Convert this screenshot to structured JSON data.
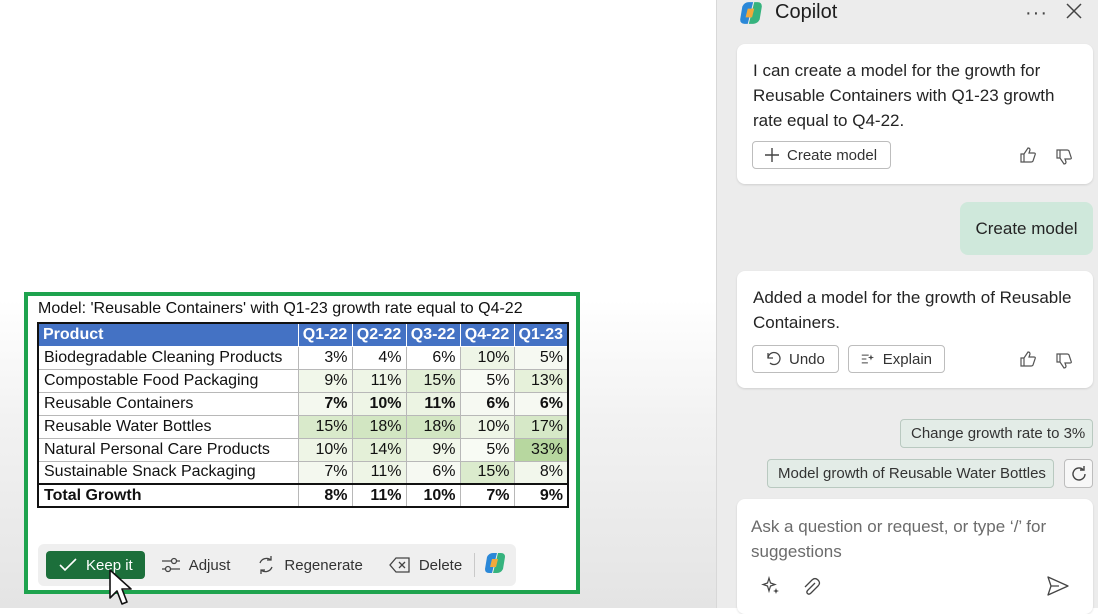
{
  "model": {
    "title": "Model: 'Reusable Containers' with Q1-23 growth rate equal to Q4-22",
    "headers": [
      "Product",
      "Q1-22",
      "Q2-22",
      "Q3-22",
      "Q4-22",
      "Q1-23"
    ],
    "rows": [
      {
        "name": "Biodegradable Cleaning Products",
        "values": [
          "3%",
          "4%",
          "6%",
          "10%",
          "5%"
        ]
      },
      {
        "name": "Compostable Food Packaging",
        "values": [
          "9%",
          "11%",
          "15%",
          "5%",
          "13%"
        ]
      },
      {
        "name": "Reusable Containers",
        "values": [
          "7%",
          "10%",
          "11%",
          "6%",
          "6%"
        ]
      },
      {
        "name": "Reusable Water Bottles",
        "values": [
          "15%",
          "18%",
          "18%",
          "10%",
          "17%"
        ]
      },
      {
        "name": "Natural Personal Care Products",
        "values": [
          "10%",
          "14%",
          "9%",
          "5%",
          "33%"
        ]
      },
      {
        "name": "Sustainable Snack Packaging",
        "values": [
          "7%",
          "11%",
          "6%",
          "15%",
          "8%"
        ]
      }
    ],
    "total": {
      "name": "Total Growth",
      "values": [
        "8%",
        "11%",
        "10%",
        "7%",
        "9%"
      ]
    },
    "toolbar": {
      "keep": "Keep it",
      "adjust": "Adjust",
      "regenerate": "Regenerate",
      "delete": "Delete"
    }
  },
  "copilot": {
    "title": "Copilot",
    "messages": {
      "m1_text": "I can create a model for the growth for Reusable Containers with Q1-23 growth rate equal to Q4-22.",
      "m1_button": "Create model",
      "user": "Create model",
      "m2_text": "Added a model for the growth of Reusable Containers.",
      "m2_undo": "Undo",
      "m2_explain": "Explain"
    },
    "suggestions": [
      "Change growth rate to 3%",
      "Model growth of Reusable Water Bottles"
    ],
    "input_placeholder": "Ask a question or request, or type ‘/’ for suggestions"
  },
  "colors": {
    "frame_green": "#1ea34e",
    "header_blue": "#4472c4",
    "keep_green": "#1c6f3b",
    "user_bubble": "#cfe8db"
  }
}
